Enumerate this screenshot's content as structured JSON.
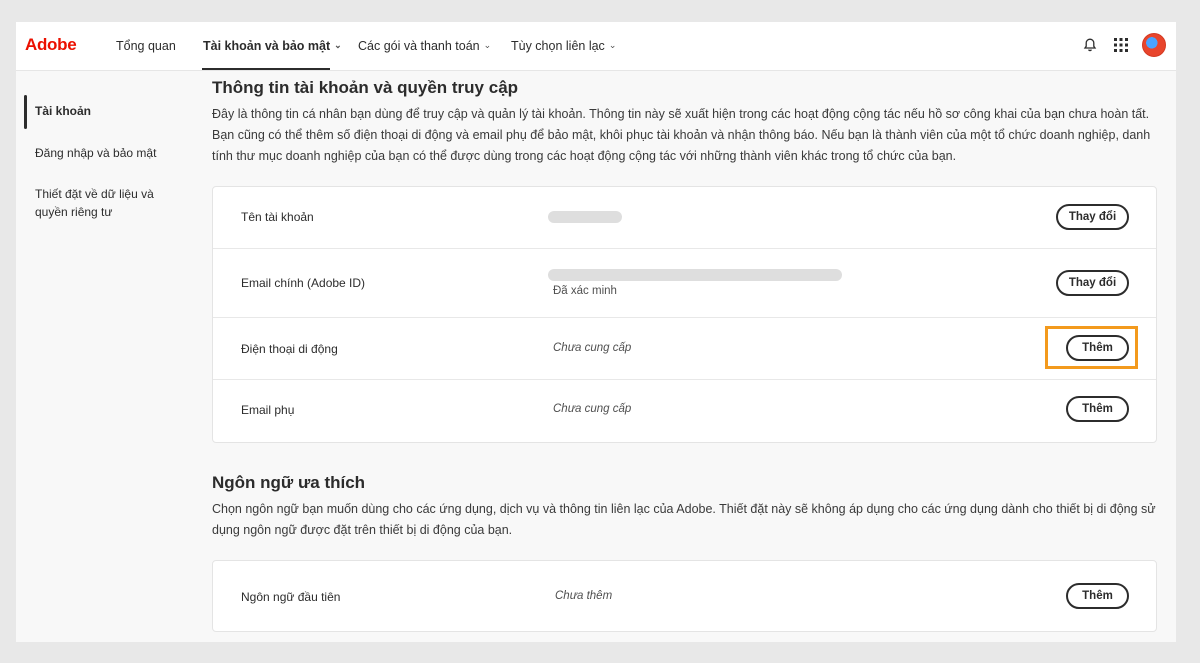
{
  "header": {
    "logo": "Adobe",
    "nav": [
      {
        "label": "Tổng quan"
      },
      {
        "label": "Tài khoản và bảo mật"
      },
      {
        "label": "Các gói và thanh toán"
      },
      {
        "label": "Tùy chọn liên lạc"
      }
    ],
    "icons": [
      "bell-icon",
      "apps-grid-icon"
    ]
  },
  "sidebar": {
    "items": [
      {
        "label": "Tài khoản"
      },
      {
        "label": "Đăng nhập và bảo mật"
      },
      {
        "label": "Thiết đặt về dữ liệu và quyền riêng tư"
      }
    ]
  },
  "account_section": {
    "title": "Thông tin tài khoản và quyền truy cập",
    "description": "Đây là thông tin cá nhân bạn dùng để truy cập và quản lý tài khoản. Thông tin này sẽ xuất hiện trong các hoạt động cộng tác nếu hồ sơ công khai của bạn chưa hoàn tất. Bạn cũng có thể thêm số điện thoại di động và email phụ để bảo mật, khôi phục tài khoản và nhận thông báo. Nếu bạn là thành viên của một tổ chức doanh nghiệp, danh tính thư mục doanh nghiệp của bạn có thể được dùng trong các hoạt động cộng tác với những thành viên khác trong tổ chức của bạn.",
    "rows": [
      {
        "label": "Tên tài khoản",
        "value": "",
        "button": "Thay đổi"
      },
      {
        "label": "Email chính (Adobe ID)",
        "value": "",
        "status": "Đã xác minh",
        "button": "Thay đổi"
      },
      {
        "label": "Điện thoại di động",
        "value": "Chưa cung cấp",
        "button": "Thêm"
      },
      {
        "label": "Email phụ",
        "value": "Chưa cung cấp",
        "button": "Thêm"
      }
    ]
  },
  "language_section": {
    "title": "Ngôn ngữ ưa thích",
    "description": "Chọn ngôn ngữ bạn muốn dùng cho các ứng dụng, dịch vụ và thông tin liên lạc của Adobe. Thiết đặt này sẽ không áp dụng cho các ứng dụng dành cho thiết bị di động sử dụng ngôn ngữ được đặt trên thiết bị di động của bạn.",
    "rows": [
      {
        "label": "Ngôn ngữ đầu tiên",
        "value": "Chưa thêm",
        "button": "Thêm"
      }
    ]
  },
  "colors": {
    "accent": "#eb1000",
    "highlight": "#f39a1d"
  }
}
